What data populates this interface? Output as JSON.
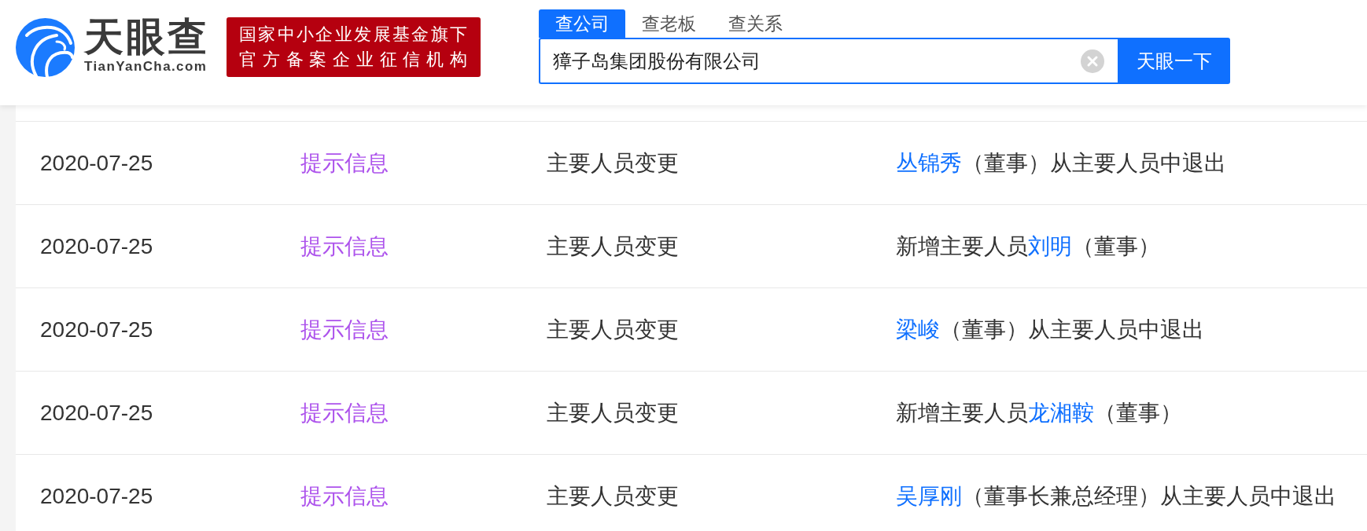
{
  "header": {
    "logo": {
      "name": "天眼查",
      "domain": "TianYanCha.com"
    },
    "badge": {
      "lines": [
        "国家中小企业发展基金旗下",
        "官方备案企业征信机构"
      ]
    }
  },
  "search": {
    "tabs": [
      {
        "label": "查公司",
        "selected": true
      },
      {
        "label": "查老板",
        "selected": false
      },
      {
        "label": "查关系",
        "selected": false
      }
    ],
    "value": "獐子岛集团股份有限公司",
    "button": "天眼一下"
  },
  "table": {
    "rows": [
      {
        "date": "2020-07-25",
        "category": "提示信息",
        "change_type": "主要人员变更",
        "description": [
          {
            "kind": "link",
            "text": "丛锦秀"
          },
          {
            "kind": "text",
            "text": "（董事）从主要人员中退出"
          }
        ]
      },
      {
        "date": "2020-07-25",
        "category": "提示信息",
        "change_type": "主要人员变更",
        "description": [
          {
            "kind": "text",
            "text": "新增主要人员"
          },
          {
            "kind": "link",
            "text": "刘明"
          },
          {
            "kind": "text",
            "text": "（董事）"
          }
        ]
      },
      {
        "date": "2020-07-25",
        "category": "提示信息",
        "change_type": "主要人员变更",
        "description": [
          {
            "kind": "link",
            "text": "梁峻"
          },
          {
            "kind": "text",
            "text": "（董事）从主要人员中退出"
          }
        ]
      },
      {
        "date": "2020-07-25",
        "category": "提示信息",
        "change_type": "主要人员变更",
        "description": [
          {
            "kind": "text",
            "text": "新增主要人员"
          },
          {
            "kind": "link",
            "text": "龙湘鞍"
          },
          {
            "kind": "text",
            "text": "（董事）"
          }
        ]
      },
      {
        "date": "2020-07-25",
        "category": "提示信息",
        "change_type": "主要人员变更",
        "description": [
          {
            "kind": "link",
            "text": "吴厚刚"
          },
          {
            "kind": "text",
            "text": "（董事长兼总经理）从主要人员中退出"
          }
        ]
      }
    ]
  }
}
